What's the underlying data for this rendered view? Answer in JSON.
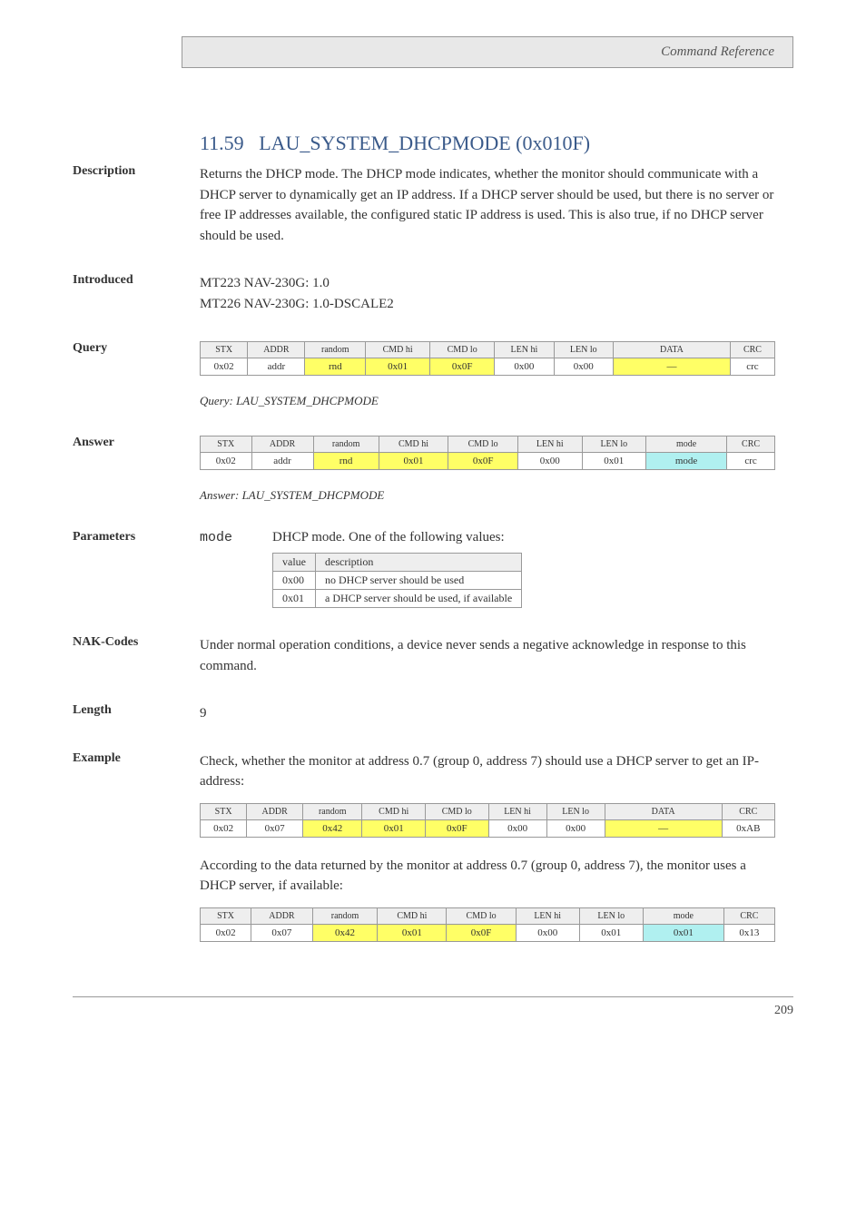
{
  "header": {
    "title": "Command Reference"
  },
  "section_number": "11.59",
  "section_title": "LAU_SYSTEM_DHCPMODE (0x010F)",
  "description_label": "Description",
  "description_text": "Returns the DHCP mode. The DHCP mode indicates, whether the monitor should communicate with a DHCP server to dynamically get an IP address. If a DHCP server should be used, but there is no server or free IP addresses available, the configured static IP address is used. This is also true, if no DHCP server should be used.",
  "introduced_label": "Introduced",
  "introduced_lines": [
    "MT223 NAV-230G: 1.0",
    "MT226 NAV-230G: 1.0-DSCALE2"
  ],
  "query_label": "Query",
  "answer_label": "Answer",
  "table_headers": [
    "STX",
    "ADDR",
    "random",
    "CMD hi",
    "CMD lo",
    "LEN hi",
    "LEN lo",
    "DATA",
    "CRC"
  ],
  "answer_headers": [
    "STX",
    "ADDR",
    "random",
    "CMD hi",
    "CMD lo",
    "LEN hi",
    "LEN lo",
    "mode",
    "CRC"
  ],
  "query_row": [
    "0x02",
    "addr",
    "rnd",
    "0x01",
    "0x0F",
    "0x00",
    "0x00",
    "—",
    "crc"
  ],
  "answer_row": [
    "0x02",
    "addr",
    "rnd",
    "0x01",
    "0x0F",
    "0x00",
    "0x01",
    "mode",
    "crc"
  ],
  "query_caption": "Query: LAU_SYSTEM_DHCPMODE",
  "answer_caption": "Answer: LAU_SYSTEM_DHCPMODE",
  "parameters_label": "Parameters",
  "param_name": "mode",
  "param_desc": "DHCP mode. One of the following values:",
  "param_table_head": [
    "value",
    "description"
  ],
  "param_table_rows": [
    [
      "0x00",
      "no DHCP server should be used"
    ],
    [
      "0x01",
      "a DHCP server should be used, if available"
    ]
  ],
  "nak_label": "NAK-Codes",
  "nak_text": "Under normal operation conditions, a device never sends a negative acknowledge in response to this command.",
  "length_label": "Length",
  "length_value": "9",
  "example_label": "Example",
  "example_intro": "Check, whether the monitor at address 0.7 (group 0, address 7) should use a DHCP server to get an IP-address:",
  "example_query_row": [
    "0x02",
    "0x07",
    "0x42",
    "0x01",
    "0x0F",
    "0x00",
    "0x00",
    "—",
    "0xAB"
  ],
  "example_mid": "According to the data returned by the monitor at address 0.7 (group 0, address 7), the monitor uses a DHCP server, if available:",
  "example_answer_row": [
    "0x02",
    "0x07",
    "0x42",
    "0x01",
    "0x0F",
    "0x00",
    "0x01",
    "0x01",
    "0x13"
  ],
  "page_number": "209"
}
